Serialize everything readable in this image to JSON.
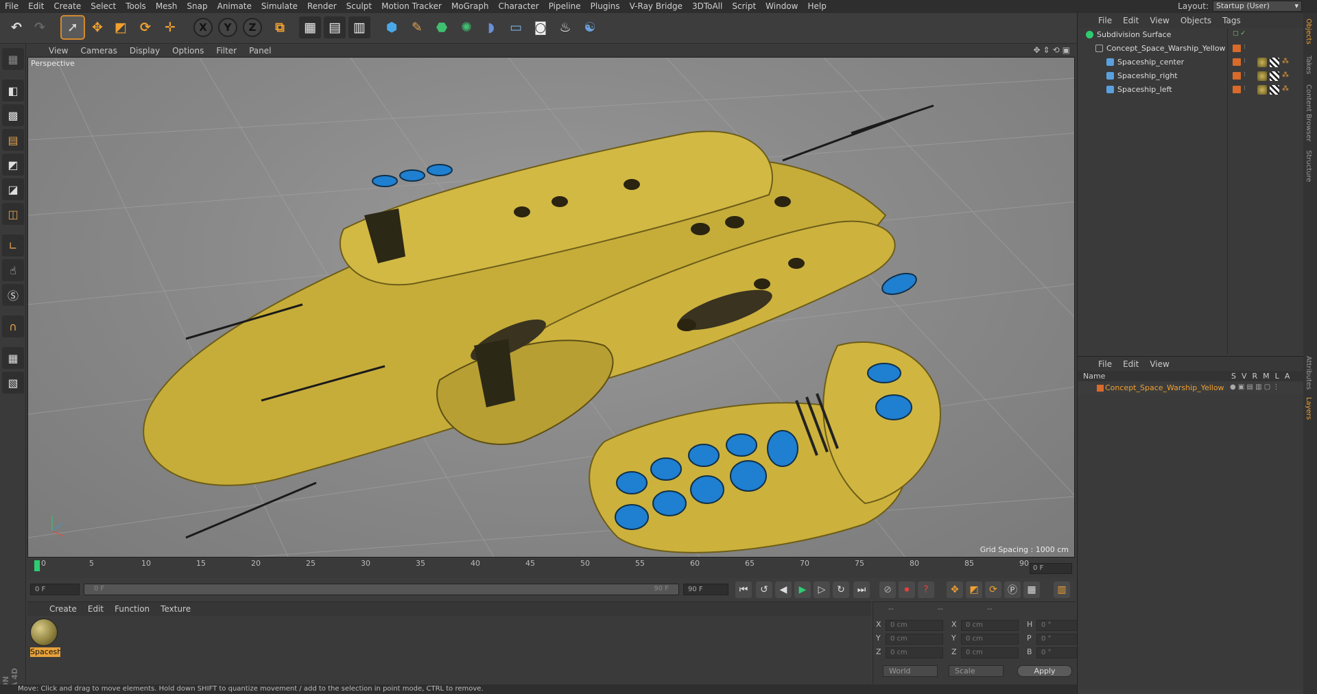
{
  "menubar": {
    "items": [
      "File",
      "Edit",
      "Create",
      "Select",
      "Tools",
      "Mesh",
      "Snap",
      "Animate",
      "Simulate",
      "Render",
      "Sculpt",
      "Motion Tracker",
      "MoGraph",
      "Character",
      "Pipeline",
      "Plugins",
      "V-Ray Bridge",
      "3DToAll",
      "Script",
      "Window",
      "Help"
    ],
    "layout_label": "Layout:",
    "layout_value": "Startup (User)"
  },
  "toolbar": {
    "undo_icon": "undo-icon",
    "axis_x": "X",
    "axis_y": "Y",
    "axis_z": "Z"
  },
  "viewport": {
    "menu": [
      "View",
      "Cameras",
      "Display",
      "Options",
      "Filter",
      "Panel"
    ],
    "label": "Perspective",
    "grid_spacing": "Grid Spacing : 1000 cm"
  },
  "timeline": {
    "ticks": [
      "0",
      "5",
      "10",
      "15",
      "20",
      "25",
      "30",
      "35",
      "40",
      "45",
      "50",
      "55",
      "60",
      "65",
      "70",
      "75",
      "80",
      "85",
      "90"
    ],
    "current_frame": "0 F"
  },
  "transport": {
    "start_field": "0 F",
    "range_start": "0 F",
    "range_end": "90 F",
    "end_field": "90 F"
  },
  "materials": {
    "menu": [
      "Create",
      "Edit",
      "Function",
      "Texture"
    ],
    "item_name": "Spacesh"
  },
  "coordinates": {
    "headers": [
      "--",
      "--",
      "--"
    ],
    "rows": [
      {
        "a": "X",
        "av": "0 cm",
        "b": "X",
        "bv": "0 cm",
        "c": "H",
        "cv": "0 °"
      },
      {
        "a": "Y",
        "av": "0 cm",
        "b": "Y",
        "bv": "0 cm",
        "c": "P",
        "cv": "0 °"
      },
      {
        "a": "Z",
        "av": "0 cm",
        "b": "Z",
        "bv": "0 cm",
        "c": "B",
        "cv": "0 °"
      }
    ],
    "mode1": "World",
    "mode2": "Scale",
    "apply": "Apply"
  },
  "status": "Move: Click and drag to move elements. Hold down SHIFT to quantize movement / add to the selection in point mode, CTRL to remove.",
  "object_manager": {
    "menu": [
      "File",
      "Edit",
      "View",
      "Objects",
      "Tags"
    ],
    "objects": [
      {
        "name": "Subdivision Surface"
      },
      {
        "name": "Concept_Space_Warship_Yellow"
      },
      {
        "name": "Spaceship_center"
      },
      {
        "name": "Spaceship_right"
      },
      {
        "name": "Spaceship_left"
      }
    ]
  },
  "layer_manager": {
    "menu": [
      "File",
      "Edit",
      "View"
    ],
    "name_header": "Name",
    "cols": [
      "S",
      "V",
      "R",
      "M",
      "L",
      "A"
    ],
    "layer_name": "Concept_Space_Warship_Yellow"
  },
  "side_tabs": [
    "Objects",
    "Takes",
    "Content Browser",
    "Structure",
    "Attributes",
    "Layers"
  ],
  "colors": {
    "accent": "#d58b2c",
    "layer_orange": "#f0a030",
    "ship_yellow": "#c9b13a",
    "ship_blue": "#1f7fd0"
  }
}
